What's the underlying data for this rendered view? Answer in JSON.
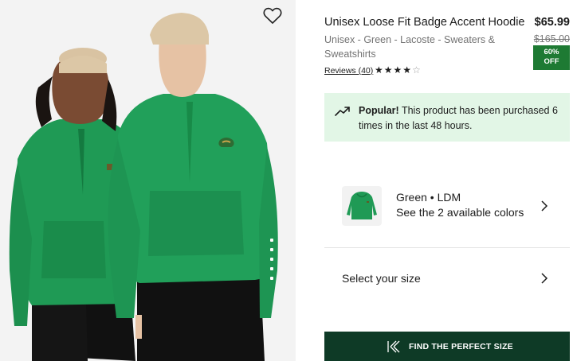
{
  "product": {
    "title": "Unisex Loose Fit Badge Accent Hoodie",
    "subtitle": "Unisex - Green - Lacoste - Sweaters & Sweatshirts",
    "price": "$65.99",
    "original_price": "$165.00",
    "discount_line1": "60%",
    "discount_line2": "OFF",
    "reviews_label": "Reviews (40)",
    "rating": 4,
    "rating_max": 5
  },
  "popular": {
    "strong": "Popular!",
    "text": " This product has been purchased 6 times in the last 48 hours."
  },
  "color_selector": {
    "name": "Green • LDM",
    "action": "See the 2 available colors"
  },
  "size_selector": {
    "label": "Select your size"
  },
  "fit_button": {
    "label": "FIND THE PERFECT SIZE"
  },
  "colors": {
    "hoodie_green": "#1f9a55",
    "promo_bg": "#e2f6e6",
    "discount_badge": "#1e7a33",
    "button_dark": "#0e3a26"
  },
  "icons": {
    "wishlist": "heart-outline-icon",
    "popular": "trending-up-icon",
    "chevron": "chevron-right-icon",
    "fit": "fit-finder-logo-icon"
  }
}
